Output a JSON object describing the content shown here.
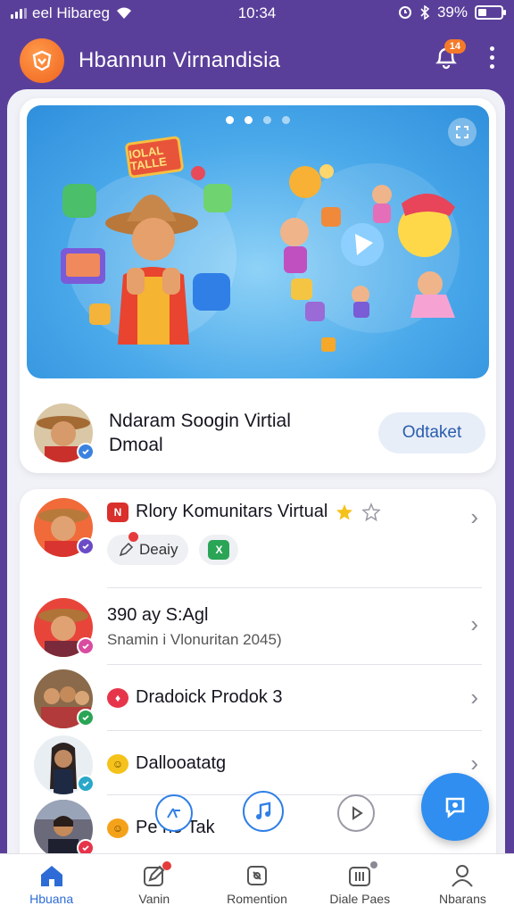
{
  "status_bar": {
    "carrier": "eel Hibareg",
    "time": "10:34",
    "battery": "39%",
    "battery_level": 0.39
  },
  "header": {
    "title": "Hbannun Virnandisia",
    "notification_count": "14",
    "logo_icon": "app-logo-icon",
    "notification_icon": "bell-icon",
    "menu_icon": "kebab-menu-icon"
  },
  "banner": {
    "sign_text": "IOLAL TALLE",
    "page_count": 4,
    "active_page": 2
  },
  "featured": {
    "title_line1": "Ndaram Soogin Virtial",
    "title_line2": "Dmoal",
    "action_label": "Odtaket"
  },
  "list": {
    "items": [
      {
        "title": "Rlory Komunitars Virtual",
        "chips": [
          "Deaiy",
          ""
        ],
        "icon": "news-tag-icon"
      },
      {
        "title": "390 ay S:Agl",
        "subtitle": "Snamin i Vlonuritan 2045)"
      },
      {
        "title": "Dradoick Prodok 3",
        "icon": "red-circle-icon"
      },
      {
        "title": "Dallooatatg",
        "icon": "emoji-icon"
      },
      {
        "title": "Pe    ne Tak",
        "icon": "emoji-icon"
      }
    ]
  },
  "bottom_nav": {
    "items": [
      {
        "label": "Hbuana",
        "icon": "home-icon"
      },
      {
        "label": "Vanin",
        "icon": "edit-icon"
      },
      {
        "label": "Romention",
        "icon": "mention-icon"
      },
      {
        "label": "Diale Paes",
        "icon": "pages-icon"
      },
      {
        "label": "Nbarans",
        "icon": "profile-icon"
      }
    ]
  },
  "colors": {
    "header_bg": "#5a3f9a",
    "accent": "#2f8ef0",
    "logo": "#f0631e"
  }
}
